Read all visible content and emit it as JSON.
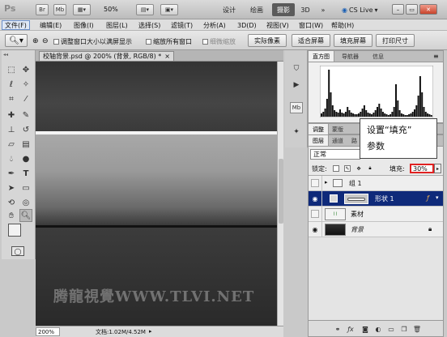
{
  "app": {
    "logo": "Ps",
    "br": "Br",
    "mb": "Mb",
    "zoom": "50%"
  },
  "workspaces": {
    "design": "设计",
    "paint": "绘画",
    "photo": "摄影",
    "threed": "3D",
    "more": "»",
    "cslive": "CS Live"
  },
  "menu": [
    "文件(F)",
    "编辑(E)",
    "图像(I)",
    "图层(L)",
    "选择(S)",
    "滤镜(T)",
    "分析(A)",
    "3D(D)",
    "视图(V)",
    "窗口(W)",
    "帮助(H)"
  ],
  "options": {
    "resize_windows": "调整窗口大小以满屏显示",
    "zoom_all": "缩放所有窗口",
    "scrubby": "细微缩放",
    "actual_pixels": "实际像素",
    "fit_screen": "适合屏幕",
    "fill_screen": "填充屏幕",
    "print_size": "打印尺寸"
  },
  "document": {
    "tab": "校轴背景.psd @ 200% (背景, RGB/8) *",
    "close": "×",
    "zoom": "200%",
    "info": "文档:1.02M/4.52M"
  },
  "watermark": "腾龍視覺WWW.TLVI.NET",
  "histogram": {
    "tabs": [
      "直方图",
      "导航器",
      "信息"
    ]
  },
  "adjust_tabs": [
    "调整",
    "蒙版"
  ],
  "layers": {
    "tabs": [
      "图层",
      "通道",
      "路"
    ],
    "blend_mode": "正常",
    "lock_label": "锁定:",
    "fill_label": "填充:",
    "fill_value": "30%",
    "rows": [
      {
        "name": "组 1",
        "italic": false
      },
      {
        "name": "形状 1",
        "italic": false
      },
      {
        "name": "素材",
        "italic": false
      },
      {
        "name": "背景",
        "italic": true
      }
    ]
  },
  "callout": {
    "line1": "设置“填充”",
    "line2": "参数"
  },
  "colors": {
    "accent_red": "#e02222",
    "selected_layer": "#0f2a7a",
    "ws_active": "#5b5b5b"
  }
}
